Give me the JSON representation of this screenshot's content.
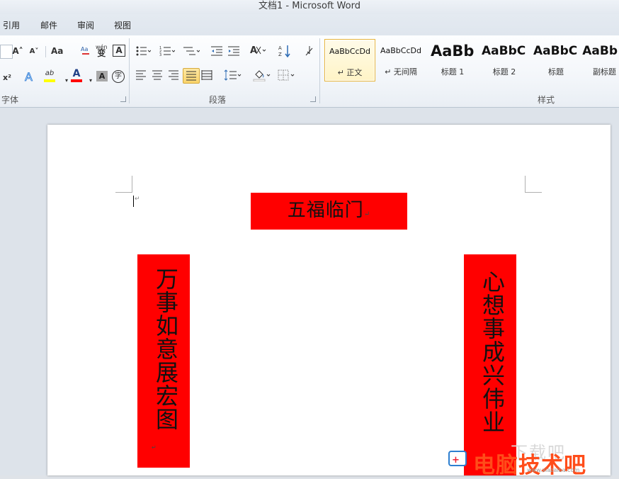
{
  "window": {
    "title": "文档1  -  Microsoft Word"
  },
  "tabs": [
    "引用",
    "邮件",
    "审阅",
    "视图"
  ],
  "ribbon": {
    "font_group": {
      "label": "字体",
      "buttons": {
        "grow_font": "A˄",
        "shrink_font": "A˅",
        "change_case": "Aa",
        "phonetic": "wén",
        "char_border": "A",
        "superscript": "x²",
        "highlight": "ab",
        "font_color": "A",
        "char_shading": "A",
        "enclose": "字"
      }
    },
    "paragraph_group": {
      "label": "段落"
    },
    "styles_group": {
      "label": "样式",
      "items": [
        {
          "preview": "AaBbCcDd",
          "name": "↵ 正文"
        },
        {
          "preview": "AaBbCcDd",
          "name": "↵ 无间隔"
        },
        {
          "preview": "AaBb",
          "name": "标题 1"
        },
        {
          "preview": "AaBbC",
          "name": "标题 2"
        },
        {
          "preview": "AaBbC",
          "name": "标题"
        },
        {
          "preview": "AaBb",
          "name": "副标题"
        }
      ]
    }
  },
  "document": {
    "top_banner": "五福临门",
    "left_couplet": "万事如意展宏图",
    "right_couplet": "心想事成兴伟业",
    "paragraph_mark": "↵"
  },
  "watermark": {
    "text": "电脑技术吧",
    "url": "www.dnjsb.com",
    "faint": "下载吧",
    "faint_url": "www.xiazaiba.com"
  },
  "colors": {
    "couplet_red": "#ff0000",
    "selected_style": "#f9d46b"
  }
}
